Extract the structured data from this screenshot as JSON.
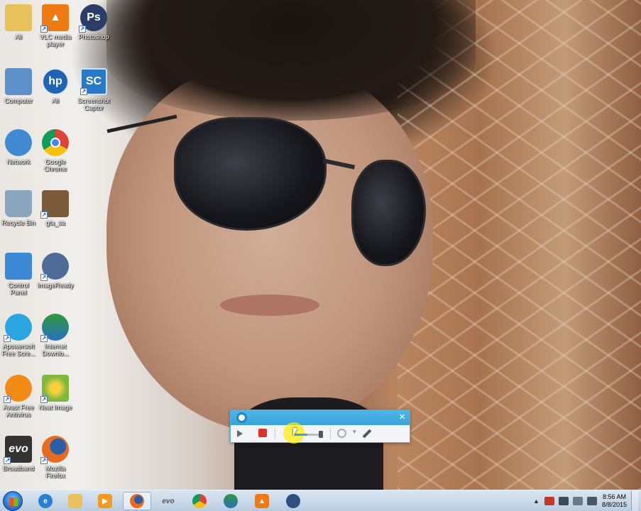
{
  "desktop": {
    "icons": [
      {
        "label": "Ali",
        "icon": "user-folder-icon",
        "color": "#e7c25a"
      },
      {
        "label": "VLC media player",
        "icon": "vlc-icon",
        "color": "#f07a12"
      },
      {
        "label": "Photoshop",
        "icon": "photoshop-icon",
        "color": "#2a3d66"
      },
      {
        "label": "Computer",
        "icon": "computer-icon",
        "color": "#5d90c9"
      },
      {
        "label": "Ali",
        "icon": "hp-icon",
        "color": "#1f63b5"
      },
      {
        "label": "Screenshot Captor",
        "icon": "screenshot-captor-icon",
        "color": "#2a78c8"
      },
      {
        "label": "Network",
        "icon": "network-icon",
        "color": "#3f8ad1"
      },
      {
        "label": "Google Chrome",
        "icon": "chrome-icon",
        "color": "#e2483b"
      },
      {
        "label": "Recycle Bin",
        "icon": "recycle-bin-icon",
        "color": "#8aa6bf"
      },
      {
        "label": "gta_sa",
        "icon": "gta-icon",
        "color": "#7b5a3a"
      },
      {
        "label": "Control Panel",
        "icon": "control-panel-icon",
        "color": "#3c8ad6"
      },
      {
        "label": "ImageReady",
        "icon": "imageready-icon",
        "color": "#4e6a96"
      },
      {
        "label": "Apowersoft Free Scre...",
        "icon": "apowersoft-icon",
        "color": "#29a6df"
      },
      {
        "label": "Internet Downlo...",
        "icon": "idm-icon",
        "color": "#2e9a3a"
      },
      {
        "label": "Avast Free Antivirus",
        "icon": "avast-icon",
        "color": "#f28a16"
      },
      {
        "label": "Neat Image",
        "icon": "neat-image-icon",
        "color": "#7fb83a"
      },
      {
        "label": "Broadband",
        "icon": "evo-broadband-icon",
        "color": "#333333"
      },
      {
        "label": "Mozilla Firefox",
        "icon": "firefox-icon",
        "color": "#e86a1f"
      }
    ],
    "glyphs": [
      "",
      "▲",
      "Ps",
      "",
      "hp",
      "SC",
      "",
      "",
      "",
      "",
      "",
      "",
      "",
      "",
      "",
      "",
      "evo",
      ""
    ]
  },
  "recorder": {
    "close": "×"
  },
  "taskbar": {
    "items": [
      {
        "icon": "ie-icon",
        "color": "#2a7fd4",
        "glyph": "e"
      },
      {
        "icon": "explorer-folder-icon",
        "color": "#e9c25b",
        "glyph": ""
      },
      {
        "icon": "media-player-icon",
        "color": "#f19a1f",
        "glyph": "▶"
      },
      {
        "icon": "firefox-icon",
        "color": "#e86a1f",
        "glyph": "",
        "active": true
      },
      {
        "icon": "evo-icon",
        "color": "#555555",
        "glyph": "evo"
      },
      {
        "icon": "chrome-icon",
        "color": "#e2483b",
        "glyph": ""
      },
      {
        "icon": "idm-icon",
        "color": "#2e9a3a",
        "glyph": ""
      },
      {
        "icon": "vlc-icon",
        "color": "#f07a12",
        "glyph": "▲"
      },
      {
        "icon": "screen-recorder-icon",
        "color": "#2f4f7f",
        "glyph": ""
      }
    ],
    "clock": {
      "time": "8:56 AM",
      "date": "8/8/2015"
    },
    "tray_arrow": "▲"
  }
}
